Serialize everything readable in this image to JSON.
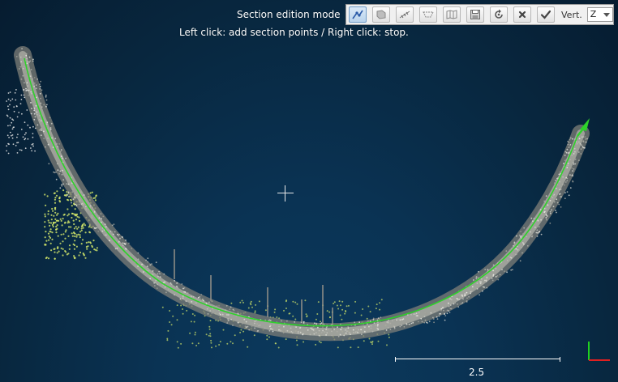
{
  "overlay": {
    "mode_title": "Section edition mode",
    "mode_hint": "Left click: add section points / Right click: stop."
  },
  "toolbar": {
    "buttons": [
      {
        "name": "edit-polyline-icon",
        "active": true
      },
      {
        "name": "import-section-icon",
        "active": false
      },
      {
        "name": "generate-orthogonal-sections-icon",
        "active": false
      },
      {
        "name": "extract-cloud-sections-icon",
        "active": false
      },
      {
        "name": "unfold-icon",
        "active": false
      },
      {
        "name": "export-sections-icon",
        "active": false
      },
      {
        "name": "reset-icon",
        "active": false
      },
      {
        "name": "cancel-icon",
        "active": false
      },
      {
        "name": "validate-icon",
        "active": false
      }
    ],
    "vert_label": "Vert.",
    "vert_value": "Z"
  },
  "scale": {
    "label": "2.5"
  },
  "colors": {
    "background": "#0a3354",
    "section_line": "#2ed12a",
    "cloud_gray": "#9c9c92",
    "vegetation": "#d8ec6a",
    "axis_x": "#e02020",
    "axis_y": "#20d020"
  }
}
